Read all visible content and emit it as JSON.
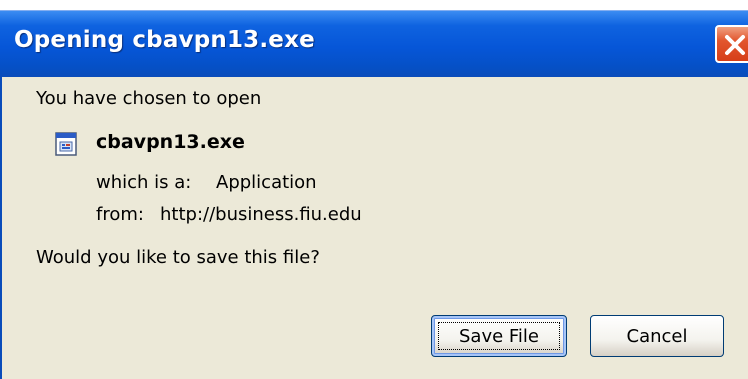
{
  "dialog": {
    "title": "Opening cbavpn13.exe",
    "intro": "You have chosen to open",
    "file_name": "cbavpn13.exe",
    "type_label": "which is a:",
    "type_value": "Application",
    "from_label": "from:",
    "from_value": "http://business.fiu.edu",
    "question": "Would you like to save this file?",
    "save_label": "Save File",
    "cancel_label": "Cancel"
  },
  "icons": {
    "close": "close-icon",
    "file": "exe-file-icon"
  },
  "colors": {
    "titlebar": "#0656d8",
    "dialog_bg": "#ece9d8",
    "close_button": "#e2562e"
  }
}
